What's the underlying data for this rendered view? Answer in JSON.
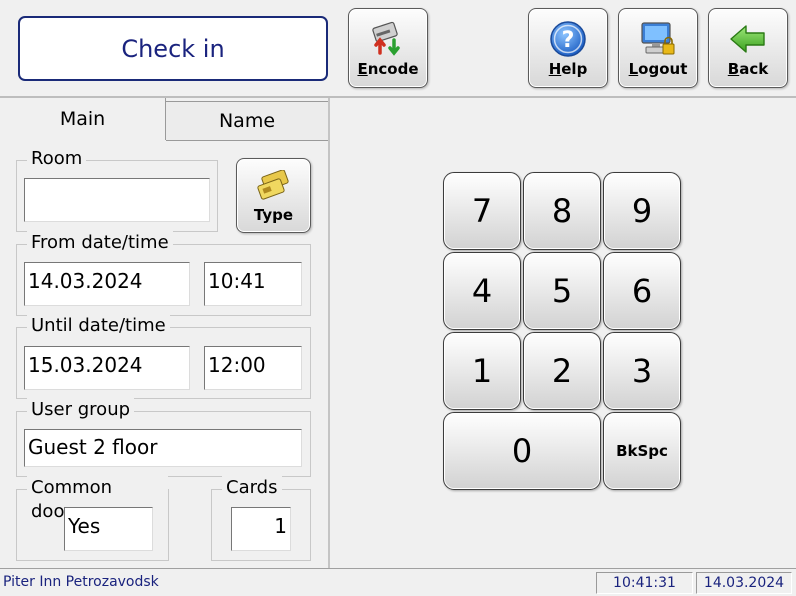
{
  "header": {
    "title": "Check in",
    "buttons": {
      "encode": {
        "label": "Encode",
        "icon": "encode-card-icon"
      },
      "help": {
        "label": "Help",
        "icon": "help-question-icon"
      },
      "logout": {
        "label": "Logout",
        "icon": "logout-computer-lock-icon"
      },
      "back": {
        "label": "Back",
        "icon": "back-arrow-icon"
      }
    }
  },
  "tabs": [
    {
      "label": "Main",
      "active": true
    },
    {
      "label": "Name",
      "active": false
    }
  ],
  "form": {
    "room": {
      "label": "Room",
      "value": ""
    },
    "type_button": {
      "label": "Type",
      "icon": "cards-icon"
    },
    "from": {
      "label": "From date/time",
      "date": "14.03.2024",
      "time": "10:41"
    },
    "until": {
      "label": "Until date/time",
      "date": "15.03.2024",
      "time": "12:00"
    },
    "user_group": {
      "label": "User group",
      "value": "Guest 2 floor"
    },
    "common_doors": {
      "label": "Common doors",
      "value": "Yes"
    },
    "cards": {
      "label": "Cards",
      "value": "1"
    }
  },
  "keypad": {
    "keys": [
      "7",
      "8",
      "9",
      "4",
      "5",
      "6",
      "1",
      "2",
      "3",
      "0",
      "BkSpc"
    ]
  },
  "status_bar": {
    "hotel": "Piter Inn Petrozavodsk",
    "time": "10:41:31",
    "date": "14.03.2024"
  },
  "colors": {
    "title_text": "#1a237e",
    "title_border": "#1a2a78",
    "status_text": "#1a237e"
  }
}
